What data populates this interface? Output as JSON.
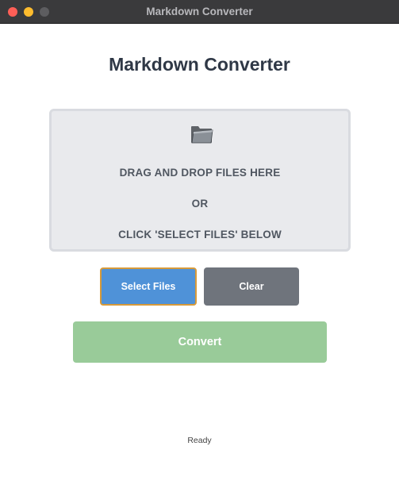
{
  "window": {
    "title": "Markdown Converter"
  },
  "app": {
    "heading": "Markdown Converter"
  },
  "dropzone": {
    "icon": "folder-icon",
    "line1": "DRAG AND DROP FILES HERE",
    "line2": "OR",
    "line3": "CLICK 'SELECT FILES' BELOW"
  },
  "buttons": {
    "select_label": "Select Files",
    "clear_label": "Clear",
    "convert_label": "Convert"
  },
  "status": {
    "text": "Ready"
  },
  "colors": {
    "select_button": "#4f92d8",
    "select_button_focus_border": "#d79a3a",
    "clear_button": "#6f747c",
    "convert_button_disabled": "#99cb99",
    "heading_text": "#2f3846"
  }
}
